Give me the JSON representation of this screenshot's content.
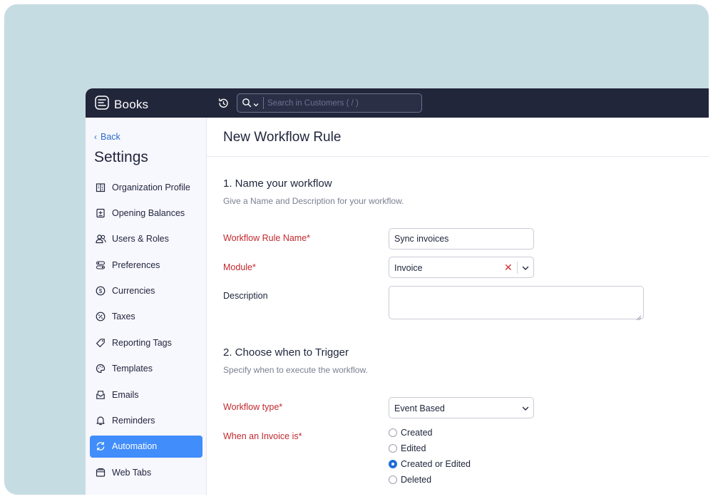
{
  "topbar": {
    "app_name": "Books",
    "search_placeholder": "Search in Customers ( / )"
  },
  "sidebar": {
    "back_label": "Back",
    "title": "Settings",
    "items": [
      {
        "label": "Organization Profile",
        "icon": "building-icon"
      },
      {
        "label": "Opening Balances",
        "icon": "ledger-icon"
      },
      {
        "label": "Users & Roles",
        "icon": "users-icon"
      },
      {
        "label": "Preferences",
        "icon": "toggles-icon"
      },
      {
        "label": "Currencies",
        "icon": "dollar-icon"
      },
      {
        "label": "Taxes",
        "icon": "percent-icon"
      },
      {
        "label": "Reporting Tags",
        "icon": "tag-icon"
      },
      {
        "label": "Templates",
        "icon": "palette-icon"
      },
      {
        "label": "Emails",
        "icon": "mail-icon"
      },
      {
        "label": "Reminders",
        "icon": "bell-icon"
      },
      {
        "label": "Automation",
        "icon": "refresh-icon",
        "active": true
      },
      {
        "label": "Web Tabs",
        "icon": "window-icon"
      }
    ]
  },
  "main": {
    "page_title": "New Workflow Rule",
    "section1": {
      "title": "1.  Name your workflow",
      "description": "Give a Name and Description for your workflow."
    },
    "fields": {
      "rule_name_label": "Workflow Rule Name*",
      "rule_name_value": "Sync invoices",
      "module_label": "Module*",
      "module_value": "Invoice",
      "description_label": "Description",
      "description_value": ""
    },
    "section2": {
      "title": "2. Choose when to Trigger",
      "description": "Specify when to execute the workflow."
    },
    "trigger": {
      "type_label": "Workflow type*",
      "type_value": "Event Based",
      "when_label": "When an Invoice is*",
      "options": [
        {
          "label": "Created",
          "checked": false
        },
        {
          "label": "Edited",
          "checked": false
        },
        {
          "label": "Created or Edited",
          "checked": true
        },
        {
          "label": "Deleted",
          "checked": false
        }
      ]
    }
  },
  "colors": {
    "topbar_bg": "#22263a",
    "sidebar_bg": "#f7f7fe",
    "accent": "#408dfb",
    "required": "#c2282d",
    "backdrop": "#c6dce3"
  }
}
